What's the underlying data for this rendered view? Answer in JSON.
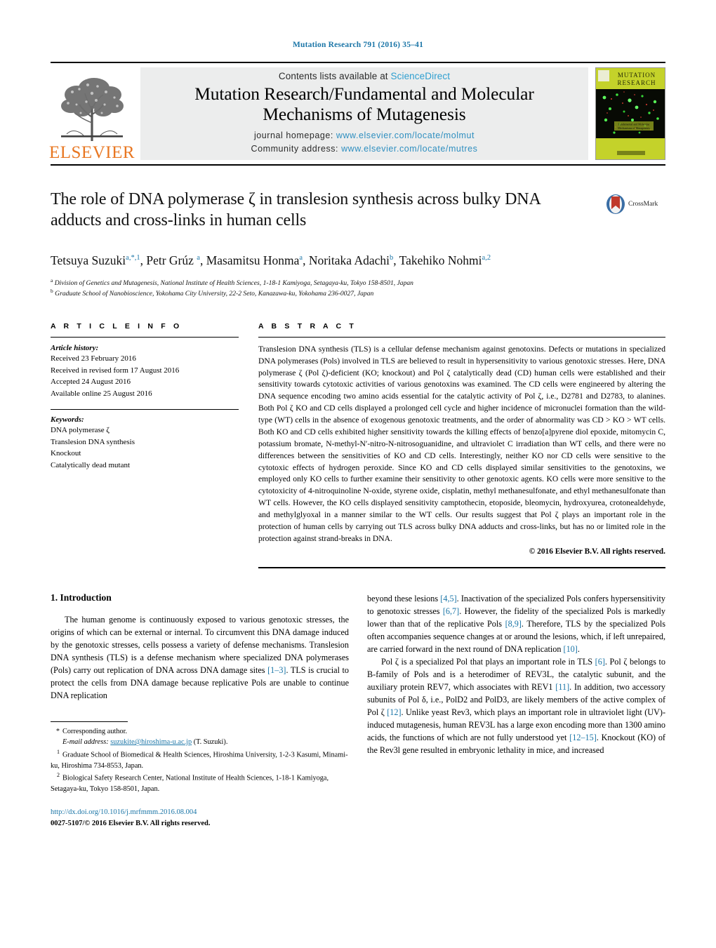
{
  "running_head": "Mutation Research 791 (2016) 35–41",
  "masthead": {
    "elsevier_wordmark": "ELSEVIER",
    "contents_prefix": "Contents lists available at ",
    "contents_link": "ScienceDirect",
    "journal_title_line1": "Mutation Research/Fundamental and Molecular",
    "journal_title_line2": "Mechanisms of Mutagenesis",
    "homepage_label": "journal homepage:",
    "homepage_url": "www.elsevier.com/locate/molmut",
    "community_label": "Community address:",
    "community_url": "www.elsevier.com/locate/mutres",
    "cover_title_line1": "MUTATION",
    "cover_title_line2": "RESEARCH",
    "cover_subtitle": "Fundamental and Molecular Mechanisms of Mutagenesis"
  },
  "article": {
    "title": "The role of DNA polymerase ζ in translesion synthesis across bulky DNA adducts and cross-links in human cells",
    "crossmark_label": "CrossMark",
    "authors_html": "Tetsuya Suzuki<sup>a,*,1</sup>, Petr Grúz <sup>a</sup>, Masamitsu Honma<sup>a</sup>, Noritaka Adachi<sup>b</sup>, Takehiko Nohmi<sup>a,2</sup>",
    "affiliation_a": "Division of Genetics and Mutagenesis, National Institute of Health Sciences, 1-18-1 Kamiyoga, Setagaya-ku, Tokyo 158-8501, Japan",
    "affiliation_b": "Graduate School of Nanobioscience, Yokohama City University, 22-2 Seto, Kanazawa-ku, Yokohama 236-0027, Japan"
  },
  "article_info": {
    "section_label": "A R T I C L E  I N F O",
    "history_head": "Article history:",
    "history": [
      "Received 23 February 2016",
      "Received in revised form 17 August 2016",
      "Accepted 24 August 2016",
      "Available online 25 August 2016"
    ],
    "keywords_head": "Keywords:",
    "keywords": [
      "DNA polymerase ζ",
      "Translesion DNA synthesis",
      "Knockout",
      "Catalytically dead mutant"
    ]
  },
  "abstract": {
    "section_label": "A B S T R A C T",
    "text": "Translesion DNA synthesis (TLS) is a cellular defense mechanism against genotoxins. Defects or mutations in specialized DNA polymerases (Pols) involved in TLS are believed to result in hypersensitivity to various genotoxic stresses. Here, DNA polymerase ζ (Pol ζ)-deficient (KO; knockout) and Pol ζ catalytically dead (CD) human cells were established and their sensitivity towards cytotoxic activities of various genotoxins was examined. The CD cells were engineered by altering the DNA sequence encoding two amino acids essential for the catalytic activity of Pol ζ, i.e., D2781 and D2783, to alanines. Both Pol ζ KO and CD cells displayed a prolonged cell cycle and higher incidence of micronuclei formation than the wild-type (WT) cells in the absence of exogenous genotoxic treatments, and the order of abnormality was CD > KO > WT cells. Both KO and CD cells exhibited higher sensitivity towards the killing effects of benzo[a]pyrene diol epoxide, mitomycin C, potassium bromate, N-methyl-N′-nitro-N-nitrosoguanidine, and ultraviolet C irradiation than WT cells, and there were no differences between the sensitivities of KO and CD cells. Interestingly, neither KO nor CD cells were sensitive to the cytotoxic effects of hydrogen peroxide. Since KO and CD cells displayed similar sensitivities to the genotoxins, we employed only KO cells to further examine their sensitivity to other genotoxic agents. KO cells were more sensitive to the cytotoxicity of 4-nitroquinoline N-oxide, styrene oxide, cisplatin, methyl methanesulfonate, and ethyl methanesulfonate than WT cells. However, the KO cells displayed sensitivity camptothecin, etoposide, bleomycin, hydroxyurea, crotonealdehyde, and methylglyoxal in a manner similar to the WT cells. Our results suggest that Pol ζ plays an important role in the protection of human cells by carrying out TLS across bulky DNA adducts and cross-links, but has no or limited role in the protection against strand-breaks in DNA.",
    "copyright": "© 2016 Elsevier B.V. All rights reserved."
  },
  "introduction": {
    "heading": "1.  Introduction",
    "para1": "The human genome is continuously exposed to various genotoxic stresses, the origins of which can be external or internal. To circumvent this DNA damage induced by the genotoxic stresses, cells possess a variety of defense mechanisms. Translesion DNA synthesis (TLS) is a defense mechanism where specialized DNA polymerases (Pols) carry out replication of DNA across DNA damage sites [1–3]. TLS is crucial to protect the cells from DNA damage because replicative Pols are unable to continue DNA replication",
    "para2": "beyond these lesions [4,5]. Inactivation of the specialized Pols confers hypersensitivity to genotoxic stresses [6,7]. However, the fidelity of the specialized Pols is markedly lower than that of the replicative Pols [8,9]. Therefore, TLS by the specialized Pols often accompanies sequence changes at or around the lesions, which, if left unrepaired, are carried forward in the next round of DNA replication [10].",
    "para3": "Pol ζ is a specialized Pol that plays an important role in TLS [6]. Pol ζ belongs to B-family of Pols and is a heterodimer of REV3L, the catalytic subunit, and the auxiliary protein REV7, which associates with REV1 [11]. In addition, two accessory subunits of Pol δ, i.e., PolD2 and PolD3, are likely members of the active complex of Pol ζ [12]. Unlike yeast Rev3, which plays an important role in ultraviolet light (UV)-induced mutagenesis, human REV3L has a large exon encoding more than 1300 amino acids, the functions of which are not fully understood yet [12–15]. Knockout (KO) of the Rev3l gene resulted in embryonic lethality in mice, and increased"
  },
  "footnotes": {
    "corresponding": "Corresponding author.",
    "email_label": "E-mail address:",
    "email": "suzukite@hiroshima-u.ac.jp",
    "email_suffix": "(T. Suzuki).",
    "note1": "Graduate School of Biomedical & Health Sciences, Hiroshima University, 1-2-3 Kasumi, Minami-ku, Hiroshima 734-8553, Japan.",
    "note2": "Biological Safety Research Center, National Institute of Health Sciences, 1-18-1 Kamiyoga, Setagaya-ku, Tokyo 158-8501, Japan.",
    "doi": "http://dx.doi.org/10.1016/j.mrfmmm.2016.08.004",
    "issn_line": "0027-5107/© 2016 Elsevier B.V. All rights reserved."
  },
  "colors": {
    "link_blue": "#1a75a7",
    "sciencedirect_blue": "#2f9fd0",
    "elsevier_orange": "#E87722",
    "band_gray": "#eceded"
  }
}
